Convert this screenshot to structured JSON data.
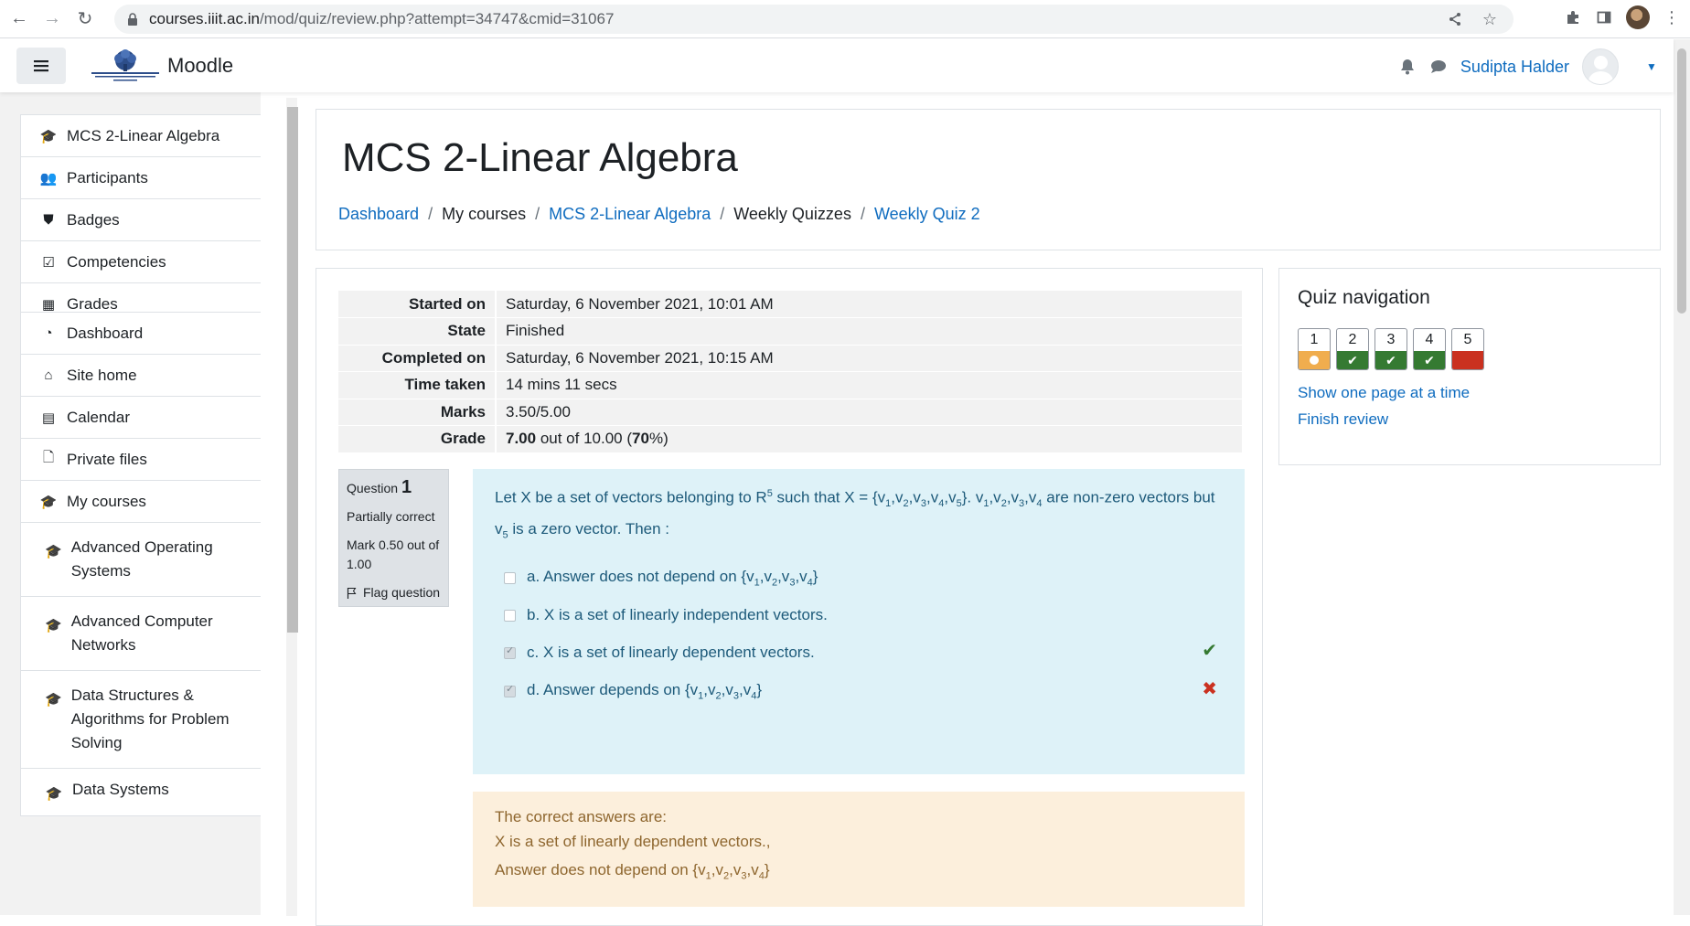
{
  "browser": {
    "url_host": "courses.iiit.ac.in",
    "url_path": "/mod/quiz/review.php?attempt=34747&cmid=31067"
  },
  "navbar": {
    "brand": "Moodle",
    "user_name": "Sudipta Halder"
  },
  "drawer": {
    "course_items": [
      {
        "label": "MCS 2-Linear Algebra",
        "icon": "graduation-cap-icon"
      },
      {
        "label": "Participants",
        "icon": "users-icon"
      },
      {
        "label": "Badges",
        "icon": "shield-icon"
      },
      {
        "label": "Competencies",
        "icon": "check-square-icon"
      },
      {
        "label": "Grades",
        "icon": "table-icon"
      }
    ],
    "site_items": [
      {
        "label": "Dashboard",
        "icon": "dashboard-icon"
      },
      {
        "label": "Site home",
        "icon": "home-icon"
      },
      {
        "label": "Calendar",
        "icon": "calendar-icon"
      },
      {
        "label": "Private files",
        "icon": "file-icon"
      },
      {
        "label": "My courses",
        "icon": "graduation-cap-icon"
      }
    ],
    "courses": [
      {
        "label": "Advanced Operating Systems"
      },
      {
        "label": "Advanced Computer Networks"
      },
      {
        "label": "Data Structures & Algorithms for Problem Solving"
      },
      {
        "label": "Data Systems"
      }
    ]
  },
  "header": {
    "title": "MCS 2-Linear Algebra",
    "breadcrumb": [
      {
        "label": "Dashboard",
        "link": true
      },
      {
        "label": "My courses",
        "link": false
      },
      {
        "label": "MCS 2-Linear Algebra",
        "link": true
      },
      {
        "label": "Weekly Quizzes",
        "link": false
      },
      {
        "label": "Weekly Quiz 2",
        "link": true
      }
    ]
  },
  "summary": {
    "rows": [
      {
        "label": "Started on",
        "value": "Saturday, 6 November 2021, 10:01 AM"
      },
      {
        "label": "State",
        "value": "Finished"
      },
      {
        "label": "Completed on",
        "value": "Saturday, 6 November 2021, 10:15 AM"
      },
      {
        "label": "Time taken",
        "value": "14 mins 11 secs"
      },
      {
        "label": "Marks",
        "value": "3.50/5.00"
      }
    ],
    "grade_label": "Grade",
    "grade_value": "7.00",
    "grade_out_of": "out of 10.00",
    "grade_percent": "70"
  },
  "question": {
    "label": "Question",
    "number": "1",
    "status": "Partially correct",
    "mark": "Mark 0.50 out of 1.00",
    "flag": "Flag question",
    "options": [
      {
        "letter": "a.",
        "checked": false,
        "mark": ""
      },
      {
        "letter": "b.",
        "text": "X is a set of linearly independent vectors.",
        "checked": false,
        "mark": ""
      },
      {
        "letter": "c.",
        "text": "X is a set of linearly dependent vectors.",
        "checked": true,
        "mark": "correct"
      },
      {
        "letter": "d.",
        "checked": true,
        "mark": "incorrect"
      }
    ]
  },
  "feedback": {
    "heading": "The correct answers are:",
    "line1": "X is a set of linearly dependent vectors.,"
  },
  "quiz_nav": {
    "title": "Quiz navigation",
    "buttons": [
      {
        "n": "1",
        "state": "partial"
      },
      {
        "n": "2",
        "state": "correct"
      },
      {
        "n": "3",
        "state": "correct"
      },
      {
        "n": "4",
        "state": "correct"
      },
      {
        "n": "5",
        "state": "incorrect"
      }
    ],
    "show_one_page": "Show one page at a time",
    "finish_review": "Finish review"
  }
}
